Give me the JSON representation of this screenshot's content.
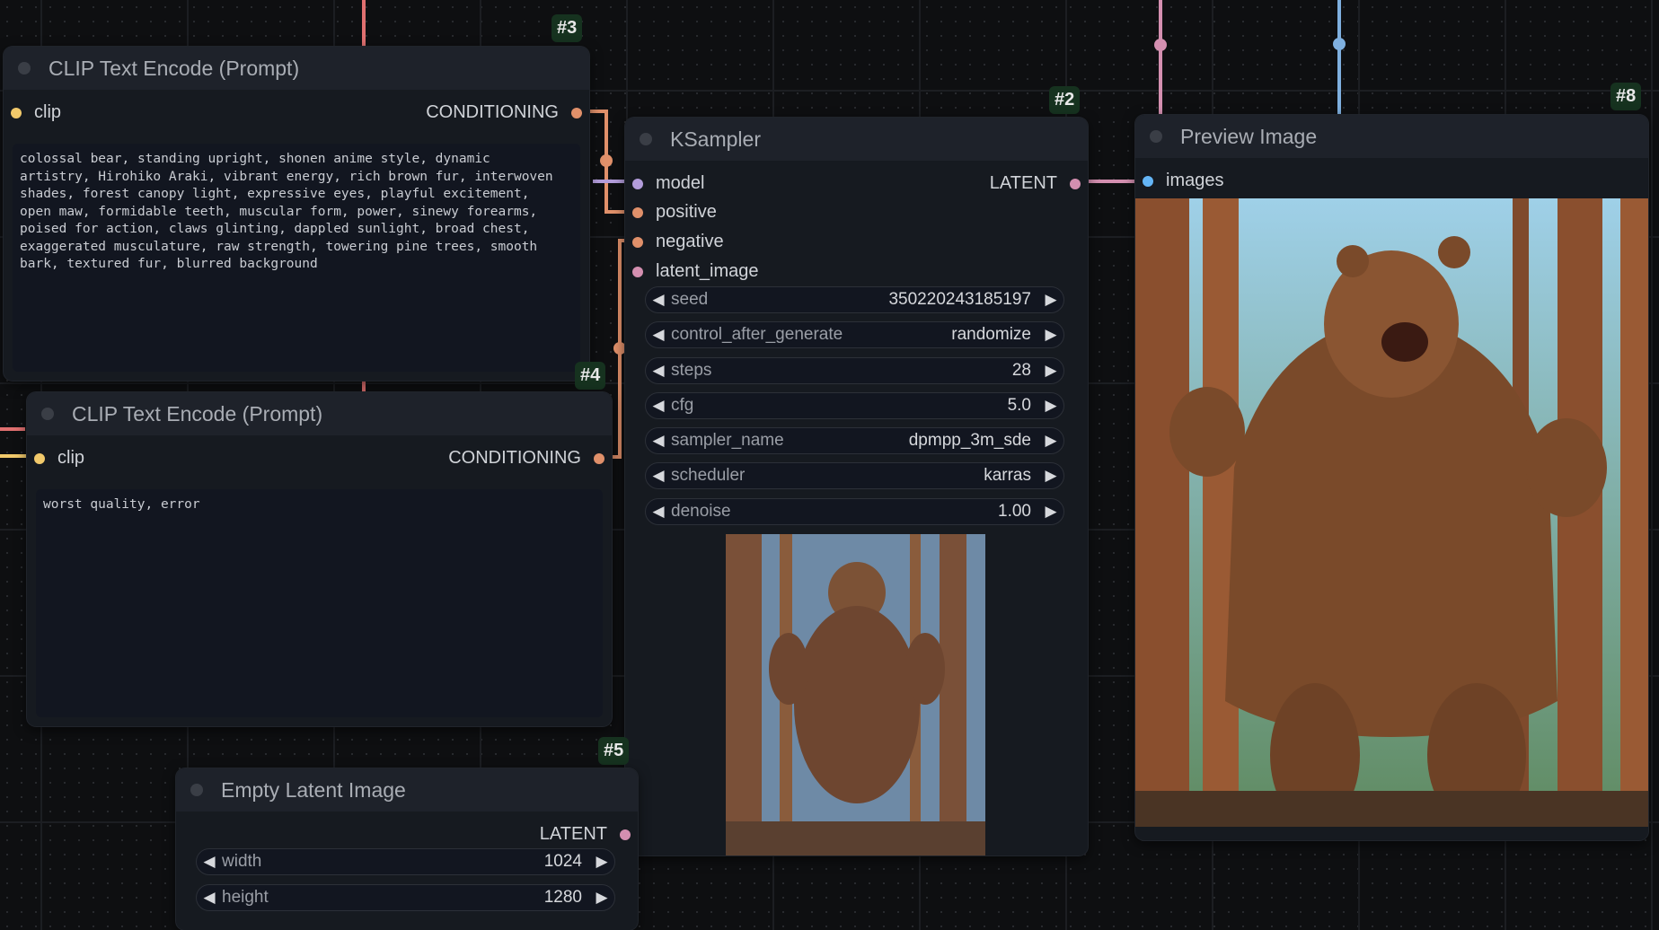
{
  "nodes": {
    "clip_pos": {
      "badge": "#3",
      "title": "CLIP Text Encode (Prompt)",
      "input": "clip",
      "output": "CONDITIONING",
      "text": "colossal bear, standing upright, shonen anime style, dynamic\nartistry, Hirohiko Araki, vibrant energy, rich brown fur, interwoven\nshades, forest canopy light, expressive eyes, playful excitement,\nopen maw, formidable teeth, muscular form, power, sinewy forearms,\npoised for action, claws glinting, dappled sunlight, broad chest,\nexaggerated musculature, raw strength, towering pine trees, smooth\nbark, textured fur, blurred background"
    },
    "clip_neg": {
      "badge": "#4",
      "title": "CLIP Text Encode (Prompt)",
      "input": "clip",
      "output": "CONDITIONING",
      "text": "worst quality, error"
    },
    "ksampler": {
      "badge": "#2",
      "title": "KSampler",
      "inputs": [
        "model",
        "positive",
        "negative",
        "latent_image"
      ],
      "output": "LATENT",
      "widgets": [
        {
          "label": "seed",
          "value": "350220243185197"
        },
        {
          "label": "control_after_generate",
          "value": "randomize"
        },
        {
          "label": "steps",
          "value": "28"
        },
        {
          "label": "cfg",
          "value": "5.0"
        },
        {
          "label": "sampler_name",
          "value": "dpmpp_3m_sde"
        },
        {
          "label": "scheduler",
          "value": "karras"
        },
        {
          "label": "denoise",
          "value": "1.00"
        }
      ]
    },
    "empty_latent": {
      "badge": "#5",
      "title": "Empty Latent Image",
      "output": "LATENT",
      "widgets": [
        {
          "label": "width",
          "value": "1024"
        },
        {
          "label": "height",
          "value": "1280"
        }
      ]
    },
    "preview": {
      "badge": "#8",
      "title": "Preview Image",
      "input": "images"
    }
  },
  "icons": {
    "arrow_left": "◀",
    "arrow_right": "▶"
  },
  "colors": {
    "clip": "#f1c96b",
    "conditioning": "#e0906a",
    "model": "#b39ddb",
    "latent": "#ff9cf9",
    "images": "#64b5f6"
  }
}
